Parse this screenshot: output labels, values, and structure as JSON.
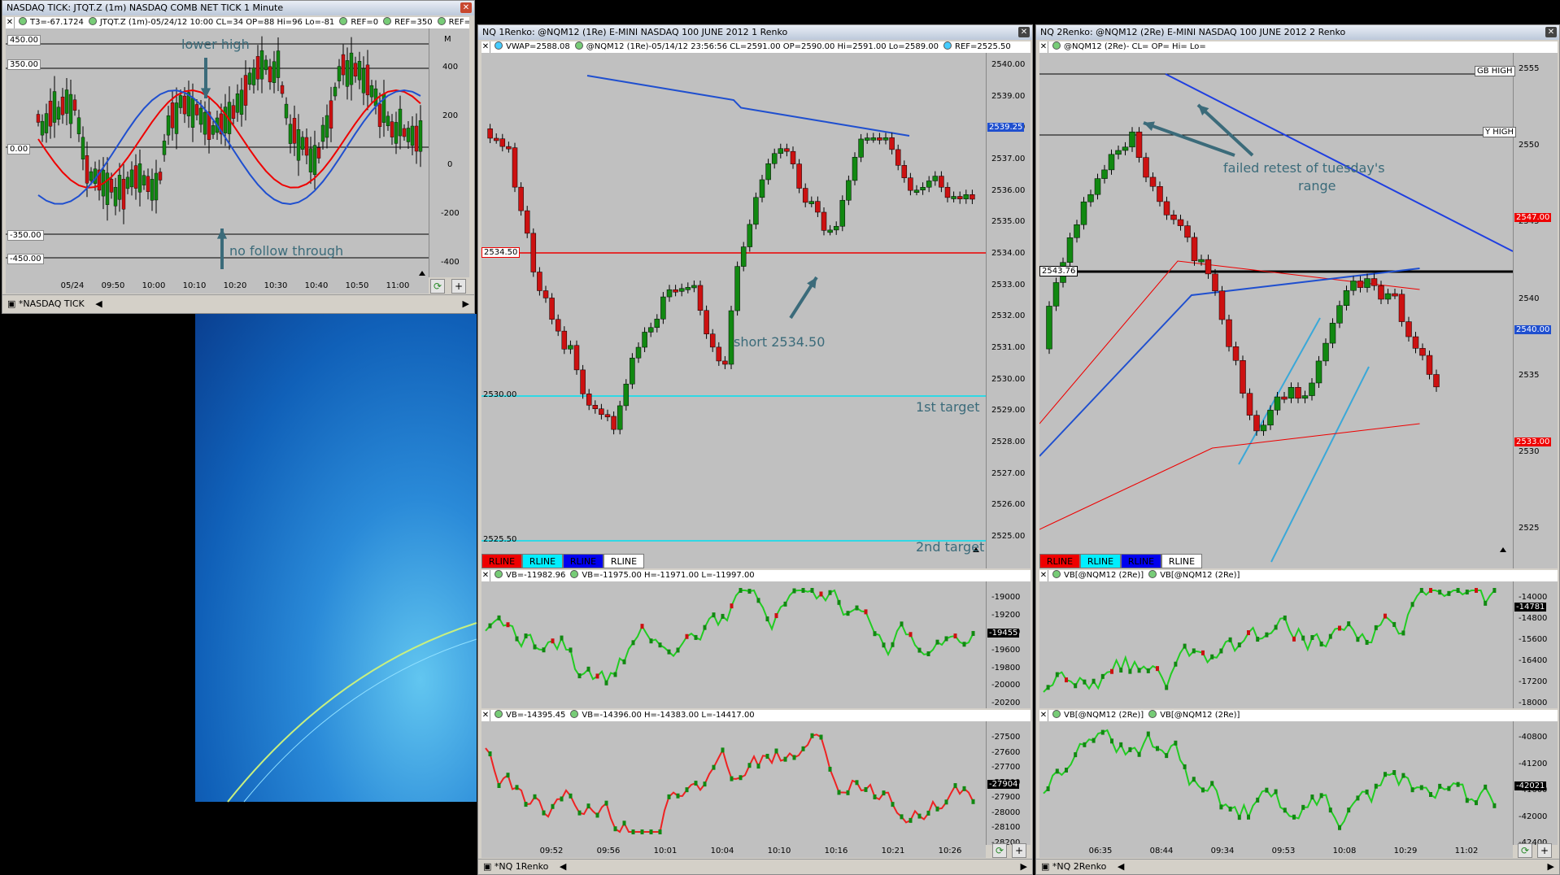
{
  "colors": {
    "up": "#118811",
    "down": "#cc1111",
    "red_line": "#ee0000",
    "blue_line": "#1f4fcf",
    "cyan_line": "#00e0f0",
    "annotation": "#3b6b7a",
    "desktop": "#1e7fd0"
  },
  "w1": {
    "title": "NASDAQ TICK: JTQT.Z (1m) NASDAQ COMB NET TICK 1 Minute",
    "hdr": [
      "T3=-67.1724",
      "JTQT.Z (1m)-05/24/12 10:00 CL=34 OP=88 Hi=96 Lo=-81",
      "REF=0",
      "REF=350",
      "REF=-450"
    ],
    "left_tags": [
      "450.00",
      "350.00",
      "0.00",
      "-350.00",
      "-450.00"
    ],
    "axis": [
      "400",
      "200",
      "0",
      "-200",
      "-400"
    ],
    "m": "M",
    "xlabels": [
      "05/24",
      "09:50",
      "10:00",
      "10:10",
      "10:20",
      "10:30",
      "10:40",
      "10:50",
      "11:00"
    ],
    "ann_lower_high": "lower high",
    "ann_no_follow": "no follow through",
    "tab": "*NASDAQ TICK"
  },
  "w2": {
    "title": "NQ 1Renko: @NQM12 (1Re) E-MINI NASDAQ 100 JUNE 2012 1 Renko",
    "hdr": [
      "VWAP=2588.08",
      "@NQM12 (1Re)-05/14/12 23:56:56 CL=2591.00 OP=2590.00 Hi=2591.00 Lo=2589.00",
      "REF=2525.50"
    ],
    "axis": [
      "2540.00",
      "2539.00",
      "2538.00",
      "2537.00",
      "2536.00",
      "2535.00",
      "2534.00",
      "2533.00",
      "2532.00",
      "2531.00",
      "2530.00",
      "2529.00",
      "2528.00",
      "2527.00",
      "2526.00",
      "2525.00"
    ],
    "tag_vwap": "2539.25",
    "tag_short": "2534.50",
    "tag_t1": "2530.00",
    "tag_t2": "2525.50",
    "ann_short": "short 2534.50",
    "ann_t1": "1st target",
    "ann_t2": "2nd target",
    "rlines": [
      "RLINE",
      "RLINE",
      "RLINE",
      "RLINE"
    ],
    "sub1_hdr": [
      "VB=-11982.96",
      "VB=-11975.00 H=-11971.00 L=-11997.00"
    ],
    "sub1_axis": [
      "-19000",
      "-19200",
      "-19400",
      "-19600",
      "-19800",
      "-20000",
      "-20200"
    ],
    "sub1_tag": "-19455",
    "sub2_hdr": [
      "VB=-14395.45",
      "VB=-14396.00 H=-14383.00 L=-14417.00"
    ],
    "sub2_axis": [
      "-27500",
      "-27600",
      "-27700",
      "-27800",
      "-27900",
      "-28000",
      "-28100",
      "-28200"
    ],
    "sub2_tag": "-27904",
    "xlabels": [
      "09:52",
      "09:56",
      "10:01",
      "10:04",
      "10:10",
      "10:16",
      "10:21",
      "10:26"
    ],
    "tab": "*NQ 1Renko"
  },
  "w3": {
    "title": "NQ 2Renko: @NQM12 (2Re) E-MINI NASDAQ 100 JUNE 2012 2 Renko",
    "hdr": [
      "@NQM12 (2Re)- CL= OP= Hi= Lo="
    ],
    "axis": [
      "2555",
      "2550",
      "2545",
      "2540",
      "2535",
      "2530",
      "2525"
    ],
    "tag_gb": "GB HIGH",
    "tag_y": "Y HIGH",
    "tag_left": "2543.76",
    "tag_upper": "2547.00",
    "tag_mid": "2540.00",
    "tag_lower": "2533.00",
    "ann_failed": "failed retest of tuesday's",
    "ann_range": "range",
    "rlines": [
      "RLINE",
      "RLINE",
      "RLINE",
      "RLINE"
    ],
    "sub1_hdr": [
      "VB[@NQM12 (2Re)]",
      "VB[@NQM12 (2Re)]"
    ],
    "sub1_axis": [
      "-14000",
      "-14800",
      "-15600",
      "-16400",
      "-17200",
      "-18000"
    ],
    "sub1_tag": "-14781",
    "sub2_hdr": [
      "VB[@NQM12 (2Re)]",
      "VB[@NQM12 (2Re)]"
    ],
    "sub2_axis": [
      "-40800",
      "-41200",
      "-41600",
      "-42000",
      "-42400"
    ],
    "sub2_tag": "-42021",
    "xlabels": [
      "06:35",
      "08:44",
      "09:34",
      "09:53",
      "10:08",
      "10:29",
      "11:02"
    ],
    "tab": "*NQ 2Renko"
  }
}
